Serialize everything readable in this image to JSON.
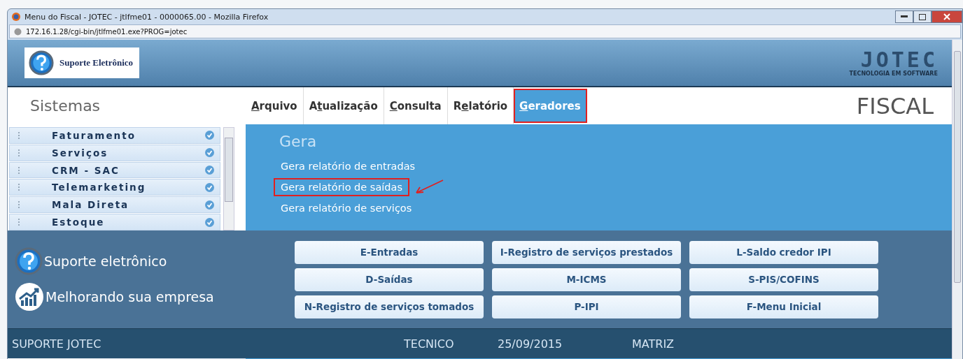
{
  "window": {
    "title": "Menu do Fiscal - JOTEC - jtlfme01 - 0000065.00 - Mozilla Firefox",
    "address": "172.16.1.28/cgi-bin/jtlfme01.exe?PROG=jotec"
  },
  "header": {
    "badge": "Suporte Eletrônico",
    "logo": "JOTEC",
    "tagline": "TECNOLOGIA EM SOFTWARE"
  },
  "sidebar": {
    "title": "Sistemas",
    "items": [
      {
        "label": "Faturamento"
      },
      {
        "label": "Serviços"
      },
      {
        "label": "CRM - SAC"
      },
      {
        "label": "Telemarketing"
      },
      {
        "label": "Mala Direta"
      },
      {
        "label": "Estoque"
      }
    ]
  },
  "menu": [
    {
      "key": "A",
      "tail": "rquivo",
      "selected": false,
      "annotated": false
    },
    {
      "lead": "A",
      "key": "t",
      "tail": "ualização",
      "selected": false,
      "annotated": false
    },
    {
      "key": "C",
      "tail": "onsulta",
      "selected": false,
      "annotated": false
    },
    {
      "lead": "R",
      "key": "e",
      "tail": "latório",
      "selected": false,
      "annotated": false
    },
    {
      "key": "G",
      "tail": "eradores",
      "selected": true,
      "annotated": true
    }
  ],
  "module": "FISCAL",
  "submenu": {
    "title": "Gera",
    "items": [
      {
        "label": "Gera relatório de entradas",
        "annotated": false
      },
      {
        "label": "Gera relatório de saídas",
        "annotated": true
      },
      {
        "label": "Gera relatório de serviços",
        "annotated": false
      }
    ]
  },
  "promo": [
    {
      "kind": "help",
      "label": "Suporte eletrônico"
    },
    {
      "kind": "chart",
      "label": "Melhorando sua empresa"
    }
  ],
  "buttons": [
    [
      "E-Entradas",
      "I-Registro de serviços prestados",
      "L-Saldo credor IPI"
    ],
    [
      "D-Saídas",
      "M-ICMS",
      "S-PIS/COFINS"
    ],
    [
      "N-Registro de serviços tomados",
      "P-IPI",
      "F-Menu Inicial"
    ]
  ],
  "status_bar": {
    "user_group": "SUPORTE JOTEC",
    "user": "TECNICO",
    "date": "25/09/2015",
    "branch": "MATRIZ"
  }
}
